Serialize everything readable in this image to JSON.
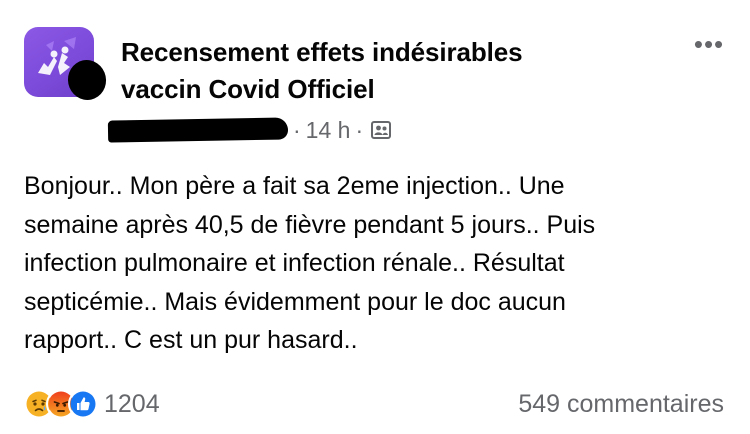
{
  "post": {
    "group_name_line1": "Recensement effets indésirables",
    "group_name_line2": "vaccin Covid Officiel",
    "time": "14 h",
    "more_icon": "more-horizontal-icon",
    "audience_icon": "group-members-icon",
    "body_lines": [
      "Bonjour.. Mon père a fait sa 2eme injection.. Une",
      "semaine après 40,5 de fièvre pendant 5 jours.. Puis",
      "infection pulmonaire et infection rénale.. Résultat",
      "septicémie.. Mais évidemment pour le doc aucun",
      "rapport.. C est un pur hasard.."
    ]
  },
  "footer": {
    "reactions": [
      "sad-reaction-icon",
      "angry-reaction-icon",
      "like-reaction-icon"
    ],
    "reaction_count": "1204",
    "comments": "549 commentaires"
  },
  "colors": {
    "group_avatar": "#7b4ad8",
    "meta_text": "#65676b",
    "like": "#1877f2",
    "angry": "#e9710f",
    "sad": "#f7b125"
  }
}
